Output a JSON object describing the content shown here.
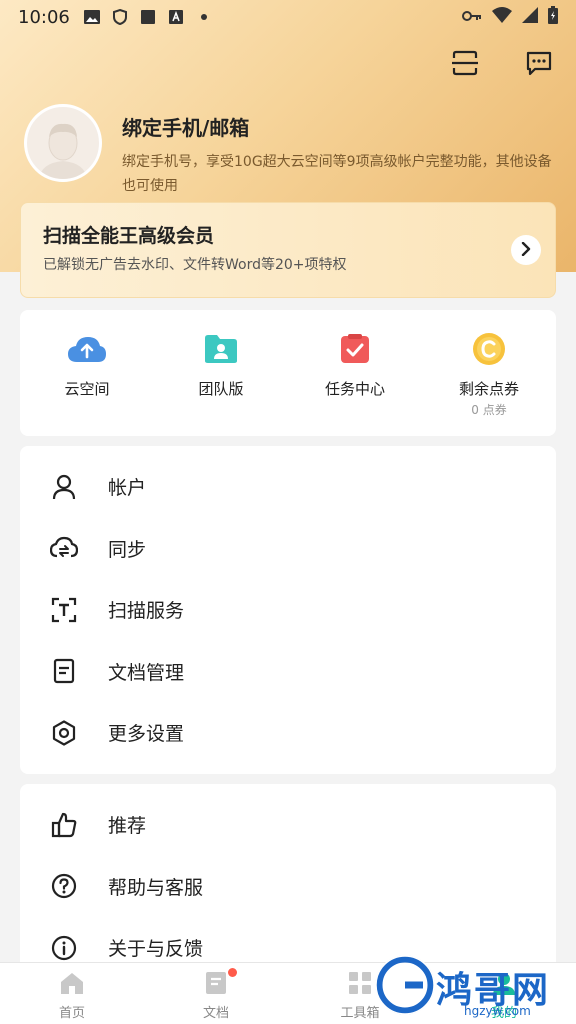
{
  "status_bar": {
    "time": "10:06"
  },
  "profile": {
    "title": "绑定手机/邮箱",
    "description": "绑定手机号，享受10G超大云空间等9项高级帐户完整功能，其他设备也可使用"
  },
  "vip": {
    "title": "扫描全能王高级会员",
    "subtitle": "已解锁无广告去水印、文件转Word等20+项特权"
  },
  "quick_grid": [
    {
      "label": "云空间",
      "icon": "cloud-upload-icon"
    },
    {
      "label": "团队版",
      "icon": "team-folder-icon"
    },
    {
      "label": "任务中心",
      "icon": "task-check-icon"
    },
    {
      "label": "剩余点券",
      "sub": "0 点券",
      "icon": "coupon-coin-icon"
    }
  ],
  "menu_main": [
    {
      "label": "帐户",
      "icon": "user-icon"
    },
    {
      "label": "同步",
      "icon": "cloud-sync-icon"
    },
    {
      "label": "扫描服务",
      "icon": "scan-text-icon"
    },
    {
      "label": "文档管理",
      "icon": "document-icon"
    },
    {
      "label": "更多设置",
      "icon": "gear-icon"
    }
  ],
  "menu_secondary": [
    {
      "label": "推荐",
      "icon": "thumbs-up-icon"
    },
    {
      "label": "帮助与客服",
      "icon": "help-icon"
    },
    {
      "label": "关于与反馈",
      "icon": "info-icon"
    }
  ],
  "tabbar": [
    {
      "label": "首页",
      "icon": "home-icon"
    },
    {
      "label": "文档",
      "icon": "docs-icon"
    },
    {
      "label": "工具箱",
      "icon": "toolbox-icon"
    },
    {
      "label": "我的",
      "icon": "me-icon"
    }
  ],
  "watermark": {
    "text": "鸿哥网",
    "url": "hgzyw.com"
  },
  "colors": {
    "accent": "#19bc9c",
    "hero_gold": "#eab56a",
    "cloud_blue": "#4a90e2",
    "team_teal": "#3cc8c1",
    "task_red": "#f05a5a",
    "coin_yellow": "#f7c23c"
  }
}
